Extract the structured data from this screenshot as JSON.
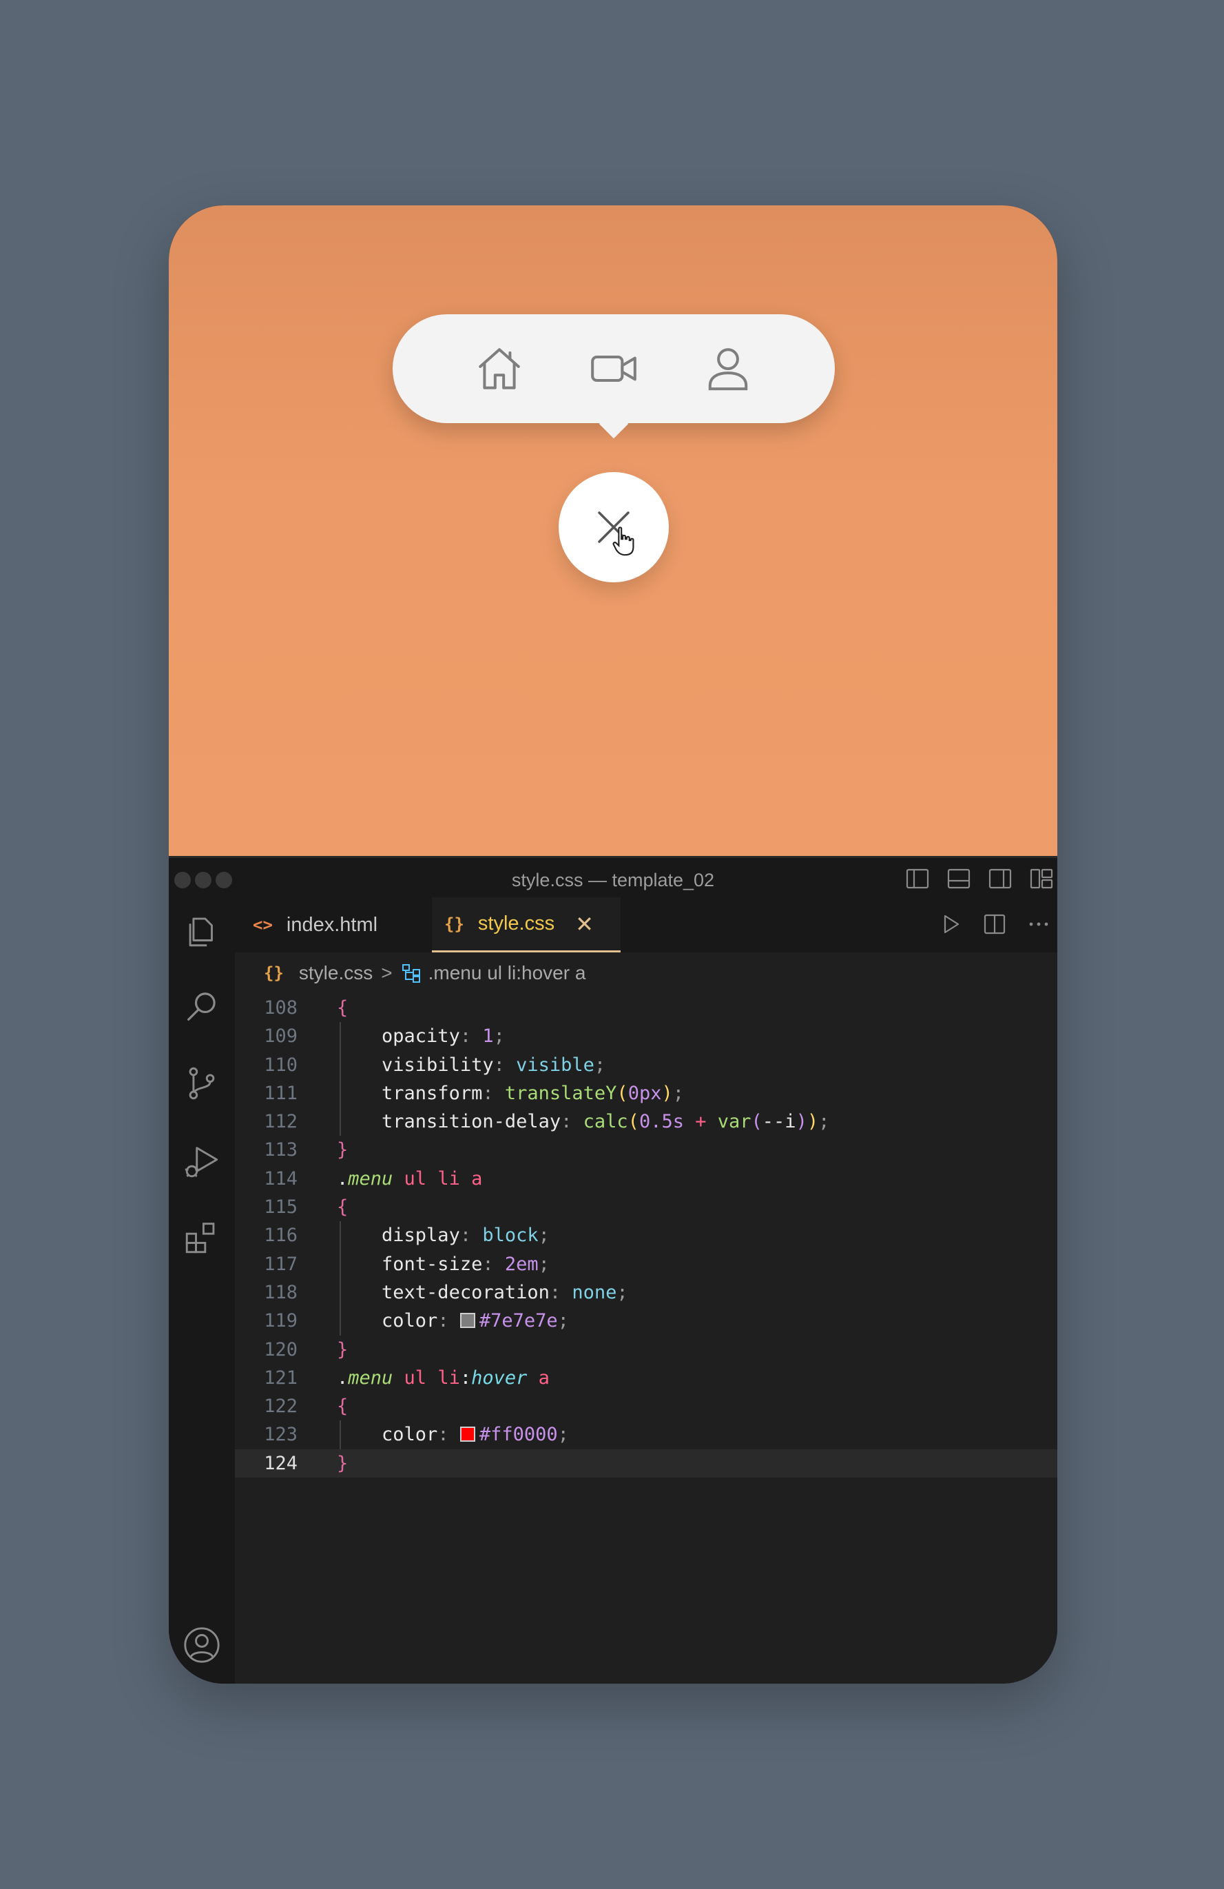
{
  "preview": {
    "menu_items": [
      {
        "icon": "home-icon"
      },
      {
        "icon": "video-camera-icon"
      },
      {
        "icon": "user-icon"
      }
    ],
    "toggle_icon": "close-icon",
    "colors": {
      "background_top": "#df8e5d",
      "background_bottom": "#ee9c69",
      "menu": "#f3f3f3",
      "icons": "#7e7e7e"
    }
  },
  "editor": {
    "window_title": "style.css — template_02",
    "tabs": [
      {
        "label": "index.html",
        "icon": "<>",
        "active": false
      },
      {
        "label": "style.css",
        "icon": "{}",
        "active": true,
        "close": "✕"
      }
    ],
    "breadcrumb": {
      "file_icon": "{}",
      "file": "style.css",
      "separator": ">",
      "symbol": ".menu ul li:hover a"
    },
    "lines": [
      {
        "n": "108",
        "tokens": [
          [
            "{",
            "c-brace"
          ]
        ],
        "indent": 0
      },
      {
        "n": "109",
        "tokens": [
          [
            "opacity",
            "c-prop"
          ],
          [
            ": ",
            "c-punc"
          ],
          [
            "1",
            "c-num"
          ],
          [
            ";",
            "c-punc"
          ]
        ],
        "indent": 1
      },
      {
        "n": "110",
        "tokens": [
          [
            "visibility",
            "c-prop"
          ],
          [
            ": ",
            "c-punc"
          ],
          [
            "visible",
            "c-kw"
          ],
          [
            ";",
            "c-punc"
          ]
        ],
        "indent": 1
      },
      {
        "n": "111",
        "tokens": [
          [
            "transform",
            "c-prop"
          ],
          [
            ": ",
            "c-punc"
          ],
          [
            "translateY",
            "c-fn"
          ],
          [
            "(",
            "c-paren"
          ],
          [
            "0px",
            "c-num"
          ],
          [
            ")",
            "c-paren"
          ],
          [
            ";",
            "c-punc"
          ]
        ],
        "indent": 1
      },
      {
        "n": "112",
        "tokens": [
          [
            "transition-delay",
            "c-prop"
          ],
          [
            ": ",
            "c-punc"
          ],
          [
            "calc",
            "c-fn"
          ],
          [
            "(",
            "c-paren"
          ],
          [
            "0.5s",
            "c-num"
          ],
          [
            " + ",
            "c-sel"
          ],
          [
            "var",
            "c-fn"
          ],
          [
            "(",
            "c-num"
          ],
          [
            "--i",
            "c-var"
          ],
          [
            ")",
            "c-num"
          ],
          [
            ")",
            "c-paren"
          ],
          [
            ";",
            "c-punc"
          ]
        ],
        "indent": 1
      },
      {
        "n": "113",
        "tokens": [
          [
            "}",
            "c-brace"
          ]
        ],
        "indent": 0
      },
      {
        "n": "114",
        "tokens": [
          [
            ".",
            "c-prop"
          ],
          [
            "menu",
            "c-selfirst"
          ],
          [
            " ul li a",
            "c-sel"
          ]
        ],
        "indent": 0
      },
      {
        "n": "115",
        "tokens": [
          [
            "{",
            "c-brace"
          ]
        ],
        "indent": 0
      },
      {
        "n": "116",
        "tokens": [
          [
            "display",
            "c-prop"
          ],
          [
            ": ",
            "c-punc"
          ],
          [
            "block",
            "c-kw"
          ],
          [
            ";",
            "c-punc"
          ]
        ],
        "indent": 1
      },
      {
        "n": "117",
        "tokens": [
          [
            "font-size",
            "c-prop"
          ],
          [
            ": ",
            "c-punc"
          ],
          [
            "2em",
            "c-num"
          ],
          [
            ";",
            "c-punc"
          ]
        ],
        "indent": 1
      },
      {
        "n": "118",
        "tokens": [
          [
            "text-decoration",
            "c-prop"
          ],
          [
            ": ",
            "c-punc"
          ],
          [
            "none",
            "c-kw"
          ],
          [
            ";",
            "c-punc"
          ]
        ],
        "indent": 1
      },
      {
        "n": "119",
        "tokens": [
          [
            "color",
            "c-prop"
          ],
          [
            ": ",
            "c-punc"
          ],
          [
            "SWATCH:#7e7e7e",
            "swatch"
          ],
          [
            "#7e7e7e",
            "c-num"
          ],
          [
            ";",
            "c-punc"
          ]
        ],
        "indent": 1
      },
      {
        "n": "120",
        "tokens": [
          [
            "}",
            "c-brace"
          ]
        ],
        "indent": 0
      },
      {
        "n": "121",
        "tokens": [
          [
            ".",
            "c-prop"
          ],
          [
            "menu",
            "c-selfirst"
          ],
          [
            " ul li",
            "c-sel"
          ],
          [
            ":",
            "c-prop"
          ],
          [
            "hover",
            "c-pseudo"
          ],
          [
            " a",
            "c-sel"
          ]
        ],
        "indent": 0
      },
      {
        "n": "122",
        "tokens": [
          [
            "{",
            "c-brace"
          ]
        ],
        "indent": 0
      },
      {
        "n": "123",
        "tokens": [
          [
            "color",
            "c-prop"
          ],
          [
            ": ",
            "c-punc"
          ],
          [
            "SWATCH:#ff0000",
            "swatch"
          ],
          [
            "#ff0000",
            "c-num"
          ],
          [
            ";",
            "c-punc"
          ]
        ],
        "indent": 1
      },
      {
        "n": "124",
        "tokens": [
          [
            "}",
            "c-brace"
          ]
        ],
        "indent": 0,
        "active": true
      }
    ],
    "activity_icons": [
      "explorer-icon",
      "search-icon",
      "source-control-icon",
      "run-debug-icon",
      "extensions-icon"
    ],
    "account_icon": "account-icon"
  }
}
